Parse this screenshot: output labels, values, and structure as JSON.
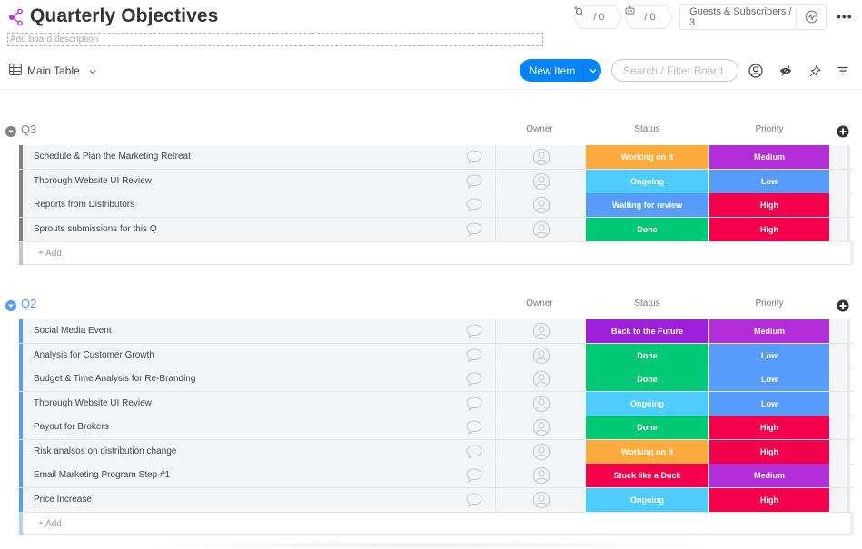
{
  "board": {
    "title": "Quarterly Objectives",
    "description_placeholder": "Add board description",
    "brand_color": "#c433d8"
  },
  "header": {
    "integrations_count": "/ 0",
    "automations_count": "/ 0",
    "guests_label": "Guests & Subscribers / 3",
    "more_label": "•••"
  },
  "toolbar": {
    "view_label": "Main Table",
    "new_item_label": "New Item",
    "search_placeholder": "Search / Filter Board"
  },
  "columns": {
    "owner": "Owner",
    "status": "Status",
    "priority": "Priority"
  },
  "status_colors": {
    "Working on it": "#fdab3d",
    "Ongoing": "#4eccfe",
    "Waiting for review": "#579bfc",
    "Done": "#00c875",
    "Back to the Future": "#9d1fd7",
    "Stuck like a Duck": "#f2004c"
  },
  "priority_colors": {
    "Medium": "#b32ed8",
    "Low": "#579bfc",
    "High": "#f2004c"
  },
  "groups": [
    {
      "title": "Q3",
      "color": "#808080",
      "title_color": "#808080",
      "add_label": "+ Add",
      "items": [
        {
          "name": "Schedule & Plan the Marketing Retreat",
          "status": "Working on it",
          "priority": "Medium"
        },
        {
          "name": "Thorough Website UI Review",
          "status": "Ongoing",
          "priority": "Low"
        },
        {
          "name": "Reports from Distributors",
          "status": "Waiting for review",
          "priority": "High"
        },
        {
          "name": "Sprouts submissions for this Q",
          "status": "Done",
          "priority": "High"
        }
      ]
    },
    {
      "title": "Q2",
      "color": "#579bfc",
      "title_color": "#579bfc",
      "add_label": "+ Add",
      "items": [
        {
          "name": "Social Media Event",
          "status": "Back to the Future",
          "priority": "Medium"
        },
        {
          "name": "Analysis for Customer Growth",
          "status": "Done",
          "priority": "Low"
        },
        {
          "name": "Budget & Time Analysis for Re-Branding",
          "status": "Done",
          "priority": "Low"
        },
        {
          "name": "Thorough Website UI Review",
          "status": "Ongoing",
          "priority": "Low"
        },
        {
          "name": "Payout for Brokers",
          "status": "Done",
          "priority": "High"
        },
        {
          "name": "Risk analsos on distribution change",
          "status": "Working on it",
          "priority": "High"
        },
        {
          "name": "Email Marketing Program Step #1",
          "status": "Stuck like a Duck",
          "priority": "Medium"
        },
        {
          "name": "Price Increase",
          "status": "Ongoing",
          "priority": "High"
        }
      ]
    }
  ]
}
